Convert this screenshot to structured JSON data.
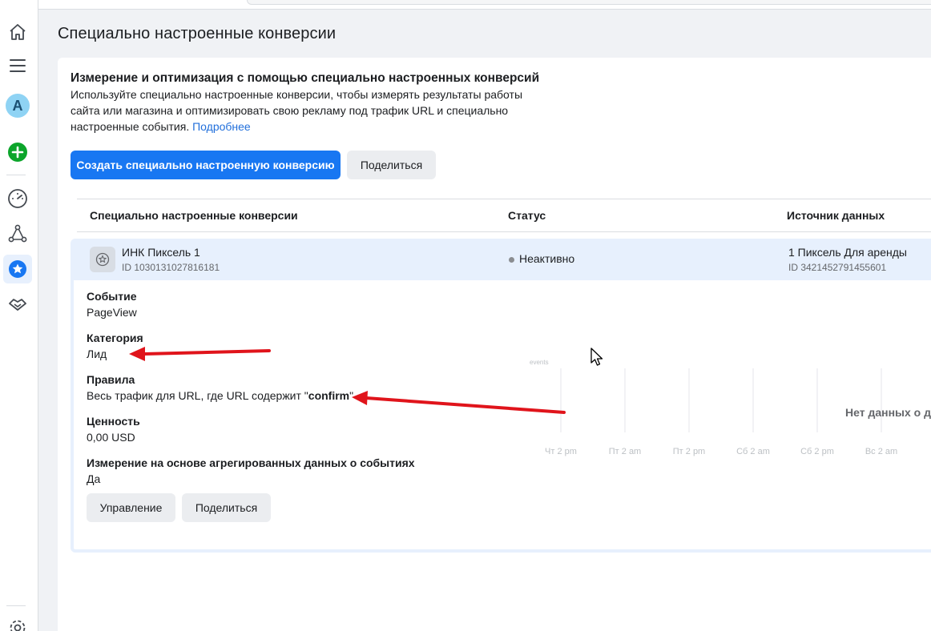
{
  "page": {
    "title": "Специально настроенные конверсии"
  },
  "intro": {
    "heading": "Измерение и оптимизация с помощью специально настроенных конверсий",
    "description": "Используйте специально настроенные конверсии, чтобы измерять результаты работы сайта или магазина и оптимизировать свою рекламу под трафик URL и специально настроенные события.",
    "learn_more": "Подробнее",
    "create_button": "Создать специально настроенную конверсию",
    "share_button": "Поделиться"
  },
  "table": {
    "columns": [
      "Специально настроенные конверсии",
      "Статус",
      "Источник данных"
    ],
    "rows": [
      {
        "name": "ИНК Пиксель 1",
        "id": "ID 1030131027816181",
        "status": "Неактивно",
        "source": "1 Пиксель Для аренды",
        "source_id": "ID 3421452791455601"
      }
    ]
  },
  "details": {
    "event_label": "Событие",
    "event_value": "PageView",
    "category_label": "Категория",
    "category_value": "Лид",
    "rules_label": "Правила",
    "rules_prefix": "Весь трафик для URL, где URL содержит \"",
    "rules_keyword": "confirm",
    "rules_suffix": "\"",
    "value_label": "Ценность",
    "value_value": "0,00 USD",
    "aggregated_label": "Измерение на основе агрегированных данных о событиях",
    "aggregated_value": "Да",
    "manage_button": "Управление",
    "share_button": "Поделиться"
  },
  "chart": {
    "no_data": "Нет данных о де",
    "y_tick": "events",
    "x_ticks": [
      "Чт 2 pm",
      "Пт 2 am",
      "Пт 2 pm",
      "Сб 2 am",
      "Сб 2 pm",
      "Вс 2 am"
    ]
  },
  "nav": {
    "avatar_letter": "A"
  },
  "colors": {
    "primary": "#1877f2",
    "selected_row": "#e7f0fd",
    "annotation_arrow": "#e0141b",
    "link": "#216fdb"
  },
  "icons": [
    "home-icon",
    "menu-icon",
    "avatar",
    "add-icon",
    "gauge-icon",
    "events-manager-icon",
    "star-icon",
    "handshake-icon",
    "settings-icon"
  ]
}
